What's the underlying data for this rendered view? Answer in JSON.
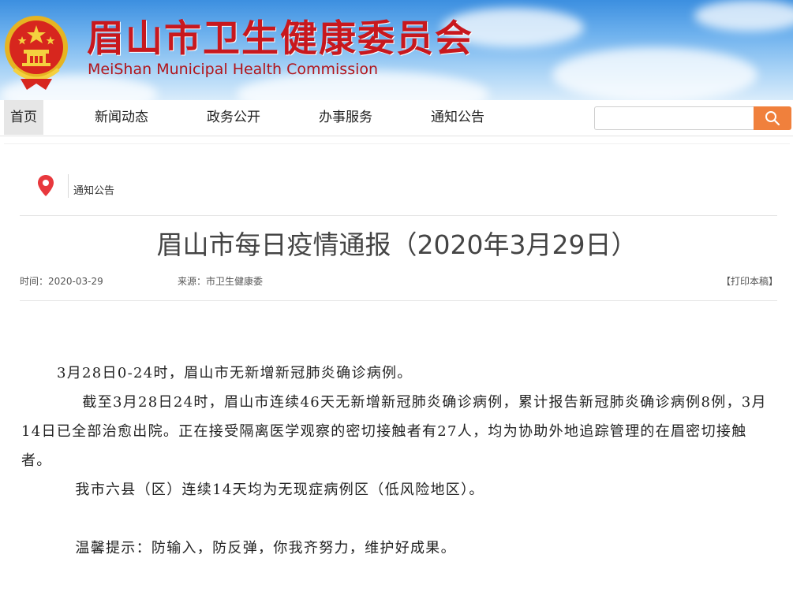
{
  "header": {
    "title": "眉山市卫生健康委员会",
    "subtitle": "MeiShan Municipal Health Commission",
    "emblem_icon": "national-emblem-icon"
  },
  "nav": {
    "items": [
      {
        "label": "首页",
        "active": true
      },
      {
        "label": "新闻动态",
        "active": false
      },
      {
        "label": "政务公开",
        "active": false
      },
      {
        "label": "办事服务",
        "active": false
      },
      {
        "label": "通知公告",
        "active": false
      }
    ],
    "search": {
      "placeholder": "",
      "button_icon": "search-icon"
    }
  },
  "breadcrumb": {
    "icon": "location-pin-icon",
    "label": "通知公告"
  },
  "article": {
    "title": "眉山市每日疫情通报（2020年3月29日）",
    "meta": {
      "time": "时间：2020-03-29",
      "source": "来源：市卫生健康委",
      "print": "【打印本稿】"
    },
    "paragraphs": [
      "3月28日0-24时，眉山市无新增新冠肺炎确诊病例。",
      "截至3月28日24时，眉山市连续46天无新增新冠肺炎确诊病例，累计报告新冠肺炎确诊病例8例，3月14日已全部治愈出院。正在接受隔离医学观察的密切接触者有27人，均为协助外地追踪管理的在眉密切接触者。",
      "我市六县（区）连续14天均为无现症病例区（低风险地区）。",
      "温馨提示：防输入，防反弹，你我齐努力，维护好成果。"
    ]
  },
  "colors": {
    "title_red": "#c8181e",
    "search_orange": "#f0803c",
    "pin_red": "#e8383d"
  }
}
